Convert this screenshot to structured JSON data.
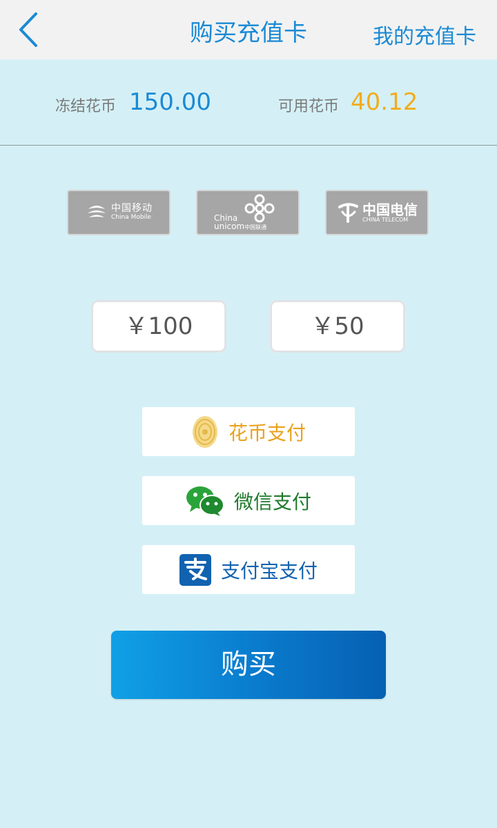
{
  "header": {
    "title": "购买充值卡",
    "right_link": "我的充值卡",
    "back_icon": "chevron-left-icon"
  },
  "balance": {
    "frozen_label": "冻结花币",
    "frozen_value": "150.00",
    "available_label": "可用花币",
    "available_value": "40.12"
  },
  "carriers": [
    {
      "name_cn": "中国移动",
      "name_en": "China Mobile",
      "icon": "china-mobile-logo"
    },
    {
      "name_cn": "中国联通",
      "name_en_1": "China",
      "name_en_2": "unicom",
      "icon": "china-unicom-logo"
    },
    {
      "name_cn": "中国电信",
      "name_en": "CHINA TELECOM",
      "icon": "china-telecom-logo"
    }
  ],
  "amounts": [
    "￥100",
    "￥50"
  ],
  "payments": [
    {
      "label": "花币支付",
      "icon": "huabi-coin-icon",
      "color": "#e9a21a"
    },
    {
      "label": "微信支付",
      "icon": "wechat-icon",
      "color": "#1f7a2c"
    },
    {
      "label": "支付宝支付",
      "icon": "alipay-icon",
      "color": "#1163b0"
    }
  ],
  "buy_label": "购买",
  "colors": {
    "accent": "#1a8ad4",
    "available": "#f2ac1c",
    "background": "#d4f0f6"
  }
}
